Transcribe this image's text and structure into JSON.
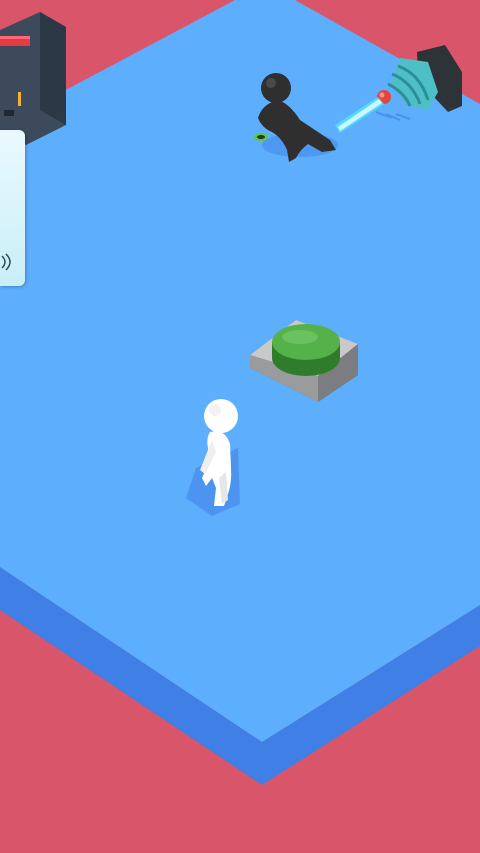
{
  "scene": {
    "background_color": "#d9556a",
    "floor_color": "#5daefc",
    "floor_edge_color": "#3f7fe6",
    "button_color": "#3f9b3a"
  },
  "characters": [
    {
      "name": "player",
      "color": "#ffffff"
    },
    {
      "name": "enemy-guard",
      "color": "#2f2f2f"
    }
  ],
  "objects": [
    {
      "name": "green-push-button"
    },
    {
      "name": "security-camera"
    },
    {
      "name": "wall-cabinet"
    }
  ],
  "icons": [
    "signal-icon"
  ]
}
